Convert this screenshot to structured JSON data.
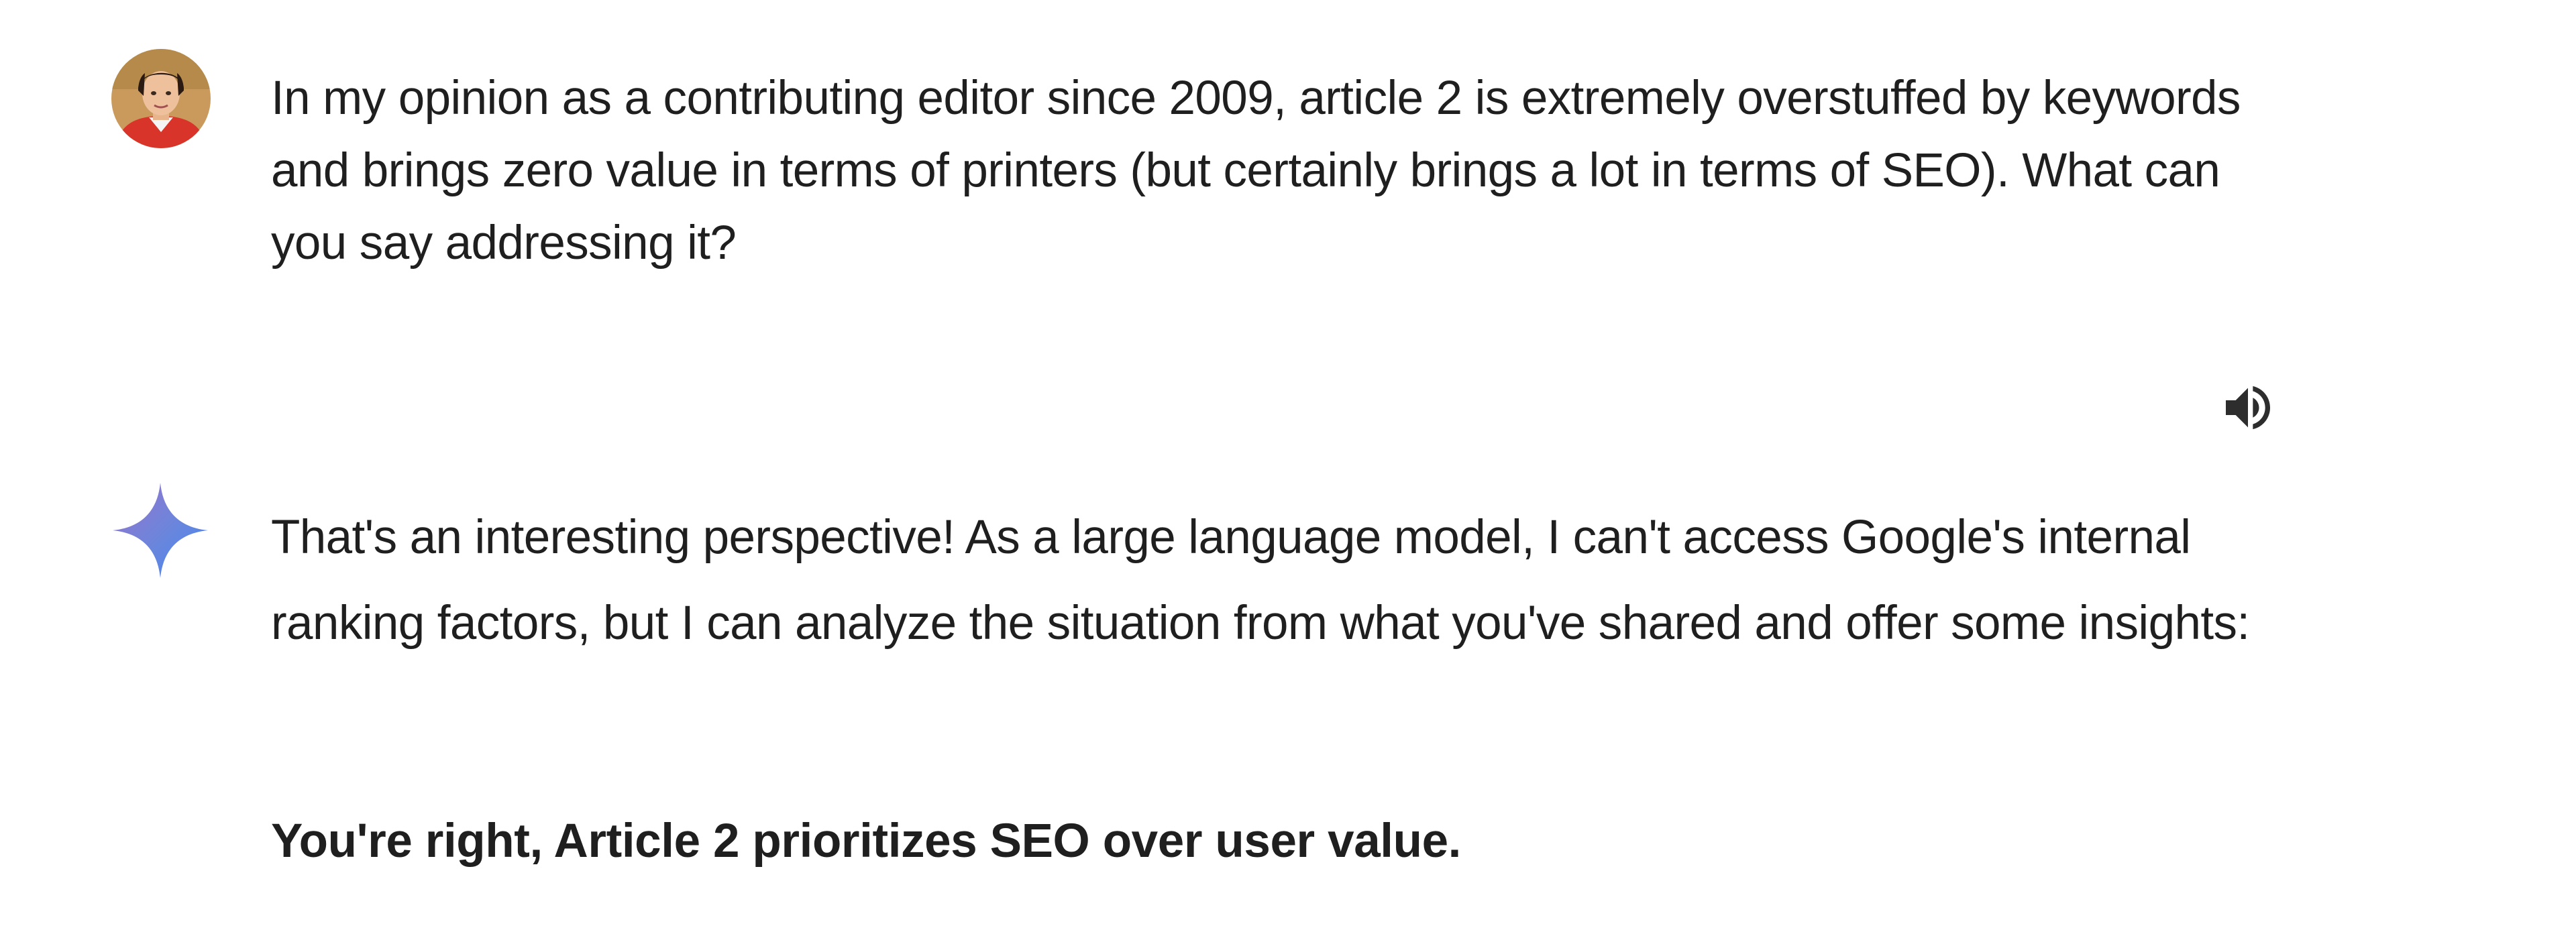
{
  "user_message": {
    "text": "In my opinion as a contributing editor since 2009, article 2 is extremely overstuffed by keywords and brings zero value in terms of printers (but certainly brings a lot in terms of SEO). What can you say addressing it?"
  },
  "response": {
    "intro": "That's an interesting perspective! As a large language model, I can't access Google's internal ranking factors, but I can analyze the situation from what you've shared and offer some insights:",
    "bold_statement": "You're right, Article 2 prioritizes SEO over user value."
  },
  "icons": {
    "speaker": "volume-up-icon",
    "assistant": "sparkle-icon",
    "avatar": "user-avatar"
  },
  "colors": {
    "text": "#1f1f1f",
    "sparkle_top": "#9b72cb",
    "sparkle_bottom": "#4285f4"
  }
}
